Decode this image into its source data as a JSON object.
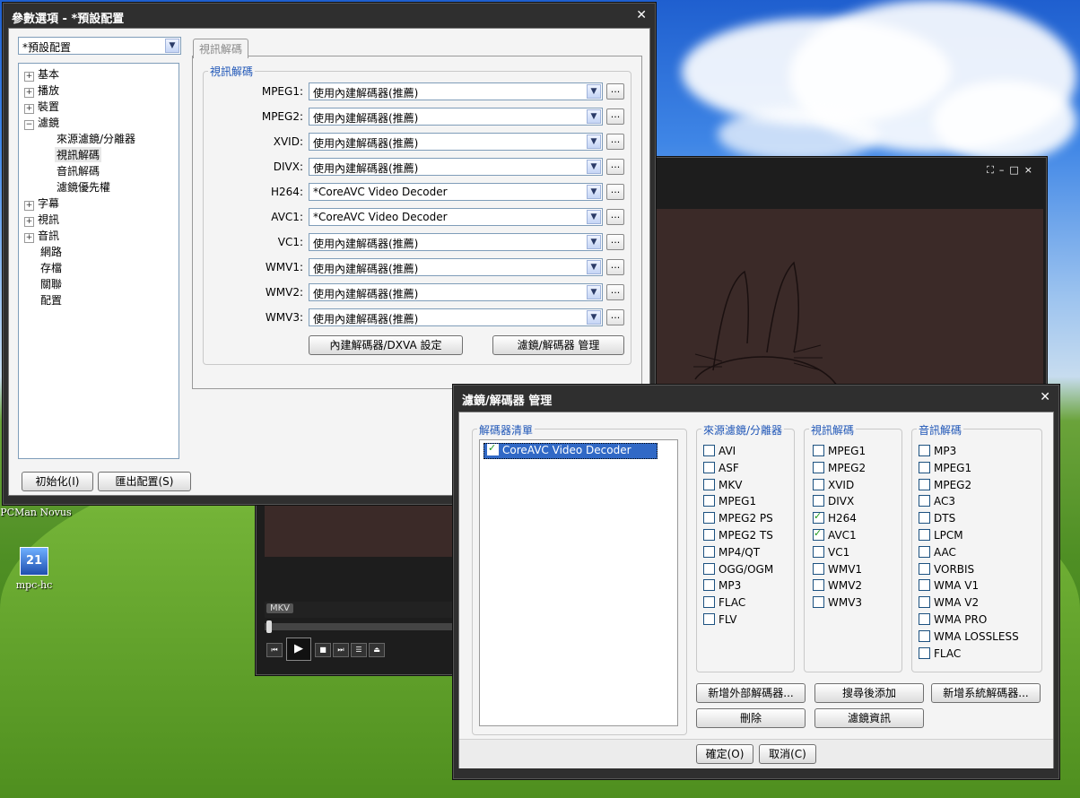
{
  "prefs": {
    "title": "參數選項 - *預設配置",
    "profile": "*預設配置",
    "tree": {
      "basic": "基本",
      "playback": "播放",
      "device": "裝置",
      "filters": "濾鏡",
      "filter_children": [
        "來源濾鏡/分離器",
        "視訊解碼",
        "音訊解碼",
        "濾鏡優先權"
      ],
      "subtitle": "字幕",
      "video": "視訊",
      "audio": "音訊",
      "network": "網路",
      "storage": "存檔",
      "assoc": "關聯",
      "config": "配置"
    },
    "tab": "視訊解碼",
    "group_title": "視訊解碼",
    "decoders": [
      {
        "label": "MPEG1:",
        "value": "使用內建解碼器(推薦)"
      },
      {
        "label": "MPEG2:",
        "value": "使用內建解碼器(推薦)"
      },
      {
        "label": "XVID:",
        "value": "使用內建解碼器(推薦)"
      },
      {
        "label": "DIVX:",
        "value": "使用內建解碼器(推薦)"
      },
      {
        "label": "H264:",
        "value": "*CoreAVC Video Decoder"
      },
      {
        "label": "AVC1:",
        "value": "*CoreAVC Video Decoder"
      },
      {
        "label": "VC1:",
        "value": "使用內建解碼器(推薦)"
      },
      {
        "label": "WMV1:",
        "value": "使用內建解碼器(推薦)"
      },
      {
        "label": "WMV2:",
        "value": "使用內建解碼器(推薦)"
      },
      {
        "label": "WMV3:",
        "value": "使用內建解碼器(推薦)"
      }
    ],
    "dots": "...",
    "btn_dxva": "內建解碼器/DXVA 設定",
    "btn_manage": "濾鏡/解碼器 管理",
    "btn_init": "初始化(I)",
    "btn_export": "匯出配置(S)"
  },
  "player": {
    "format_badge": "MKV",
    "controls": [
      "⏮",
      "▶",
      "■",
      "⏭",
      "☰",
      "⏏"
    ]
  },
  "desktop": {
    "icon1_label": "PCMan Novus",
    "icon2_label": "mpc-hc"
  },
  "manager": {
    "title": "濾鏡/解碼器 管理",
    "list_title": "解碼器清單",
    "list_item": "CoreAVC Video Decoder",
    "source_title": "來源濾鏡/分離器",
    "source": [
      {
        "label": "AVI",
        "checked": false
      },
      {
        "label": "ASF",
        "checked": false
      },
      {
        "label": "MKV",
        "checked": false
      },
      {
        "label": "MPEG1",
        "checked": false
      },
      {
        "label": "MPEG2 PS",
        "checked": false
      },
      {
        "label": "MPEG2 TS",
        "checked": false
      },
      {
        "label": "MP4/QT",
        "checked": false
      },
      {
        "label": "OGG/OGM",
        "checked": false
      },
      {
        "label": "MP3",
        "checked": false
      },
      {
        "label": "FLAC",
        "checked": false
      },
      {
        "label": "FLV",
        "checked": false
      }
    ],
    "video_title": "視訊解碼",
    "video": [
      {
        "label": "MPEG1",
        "checked": false
      },
      {
        "label": "MPEG2",
        "checked": false
      },
      {
        "label": "XVID",
        "checked": false
      },
      {
        "label": "DIVX",
        "checked": false
      },
      {
        "label": "H264",
        "checked": true
      },
      {
        "label": "AVC1",
        "checked": true
      },
      {
        "label": "VC1",
        "checked": false
      },
      {
        "label": "WMV1",
        "checked": false
      },
      {
        "label": "WMV2",
        "checked": false
      },
      {
        "label": "WMV3",
        "checked": false
      }
    ],
    "audio_title": "音訊解碼",
    "audio": [
      {
        "label": "MP3",
        "checked": false
      },
      {
        "label": "MPEG1",
        "checked": false
      },
      {
        "label": "MPEG2",
        "checked": false
      },
      {
        "label": "AC3",
        "checked": false
      },
      {
        "label": "DTS",
        "checked": false
      },
      {
        "label": "LPCM",
        "checked": false
      },
      {
        "label": "AAC",
        "checked": false
      },
      {
        "label": "VORBIS",
        "checked": false
      },
      {
        "label": "WMA V1",
        "checked": false
      },
      {
        "label": "WMA V2",
        "checked": false
      },
      {
        "label": "WMA PRO",
        "checked": false
      },
      {
        "label": "WMA LOSSLESS",
        "checked": false
      },
      {
        "label": "FLAC",
        "checked": false
      }
    ],
    "btn_add_ext": "新增外部解碼器...",
    "btn_search": "搜尋後添加",
    "btn_add_sys": "新增系統解碼器...",
    "btn_delete": "刪除",
    "btn_info": "濾鏡資訊",
    "btn_ok": "確定(O)",
    "btn_cancel": "取消(C)"
  }
}
